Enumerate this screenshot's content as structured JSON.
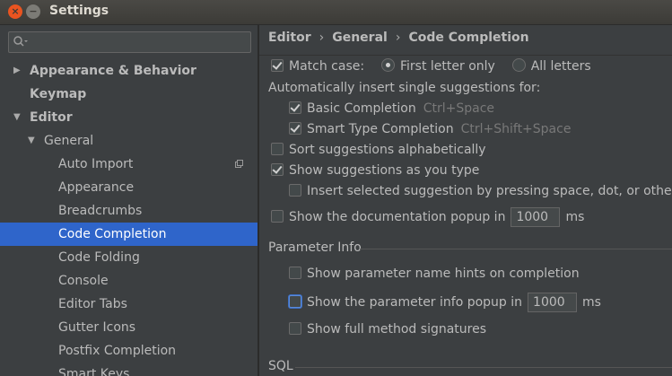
{
  "window": {
    "title": "Settings",
    "close_glyph": "×",
    "min_glyph": "−"
  },
  "sidebar": {
    "search_placeholder": "",
    "items": [
      {
        "label": "Appearance & Behavior"
      },
      {
        "label": "Keymap"
      },
      {
        "label": "Editor"
      },
      {
        "label": "General"
      },
      {
        "label": "Auto Import"
      },
      {
        "label": "Appearance"
      },
      {
        "label": "Breadcrumbs"
      },
      {
        "label": "Code Completion",
        "selected": true
      },
      {
        "label": "Code Folding"
      },
      {
        "label": "Console"
      },
      {
        "label": "Editor Tabs"
      },
      {
        "label": "Gutter Icons"
      },
      {
        "label": "Postfix Completion"
      },
      {
        "label": "Smart Keys"
      }
    ]
  },
  "breadcrumb": [
    "Editor",
    "General",
    "Code Completion"
  ],
  "breadcrumb_sep": "›",
  "settings": {
    "match_case": {
      "label": "Match case:",
      "checked": true
    },
    "first_letter": {
      "label": "First letter only",
      "selected": true
    },
    "all_letters": {
      "label": "All letters",
      "selected": false
    },
    "auto_insert_heading": "Automatically insert single suggestions for:",
    "basic_completion": {
      "label": "Basic Completion",
      "hint": "Ctrl+Space",
      "checked": true
    },
    "smart_type": {
      "label": "Smart Type Completion",
      "hint": "Ctrl+Shift+Space",
      "checked": true
    },
    "sort_alpha": {
      "label": "Sort suggestions alphabetically",
      "checked": false
    },
    "show_as_type": {
      "label": "Show suggestions as you type",
      "checked": true
    },
    "insert_selected": {
      "label": "Insert selected suggestion by pressing space, dot, or other c",
      "checked": false
    },
    "doc_popup": {
      "label": "Show the documentation popup in",
      "value": "1000",
      "unit": "ms",
      "checked": false
    }
  },
  "parameter_info": {
    "title": "Parameter Info",
    "name_hints": {
      "label": "Show parameter name hints on completion",
      "checked": false
    },
    "info_popup": {
      "label": "Show the parameter info popup in",
      "value": "1000",
      "unit": "ms",
      "checked": false
    },
    "full_signatures": {
      "label": "Show full method signatures",
      "checked": false
    }
  },
  "sql": {
    "title": "SQL"
  }
}
